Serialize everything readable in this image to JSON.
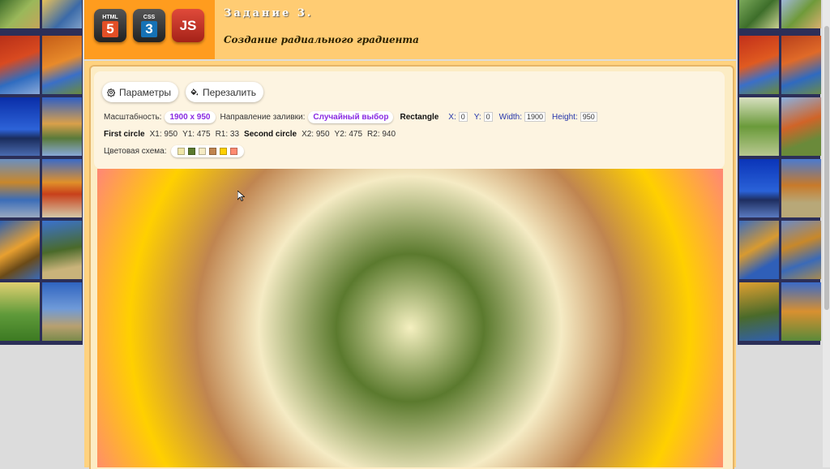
{
  "header": {
    "title": "Задание 3.",
    "subtitle": "Создание радиального градиента",
    "tech_badges": [
      {
        "top": "HTML",
        "bottom": "5",
        "color": "#e34f26"
      },
      {
        "top": "CSS",
        "bottom": "3",
        "color": "#1572b6"
      },
      {
        "top": "",
        "bottom": "JS",
        "color": "#c0392b"
      }
    ]
  },
  "toolbar": {
    "params_label": "Параметры",
    "refill_label": "Перезалить"
  },
  "settings": {
    "scale_label": "Масштабность:",
    "scale_value": "1900 x 950",
    "direction_label": "Направление заливки:",
    "direction_value": "Случайный выбор",
    "rect_label": "Rectangle",
    "x_label": "X:",
    "x_value": "0",
    "y_label": "Y:",
    "y_value": "0",
    "width_label": "Width:",
    "width_value": "1900",
    "height_label": "Height:",
    "height_value": "950",
    "first_circle_label": "First circle",
    "x1": "X1: 950",
    "y1": "Y1: 475",
    "r1": "R1: 33",
    "second_circle_label": "Second circle",
    "x2": "X2: 950",
    "y2": "Y2: 475",
    "r2": "R2: 940",
    "color_scheme_label": "Цветовая схема:",
    "color_scheme": [
      "#f0e6a8",
      "#5b7a2e",
      "#f5ebc4",
      "#c08550",
      "#ffd000",
      "#ff8a70"
    ]
  },
  "icons": [
    "gear-icon",
    "paint-bucket-icon",
    "mouse-cursor-icon"
  ]
}
